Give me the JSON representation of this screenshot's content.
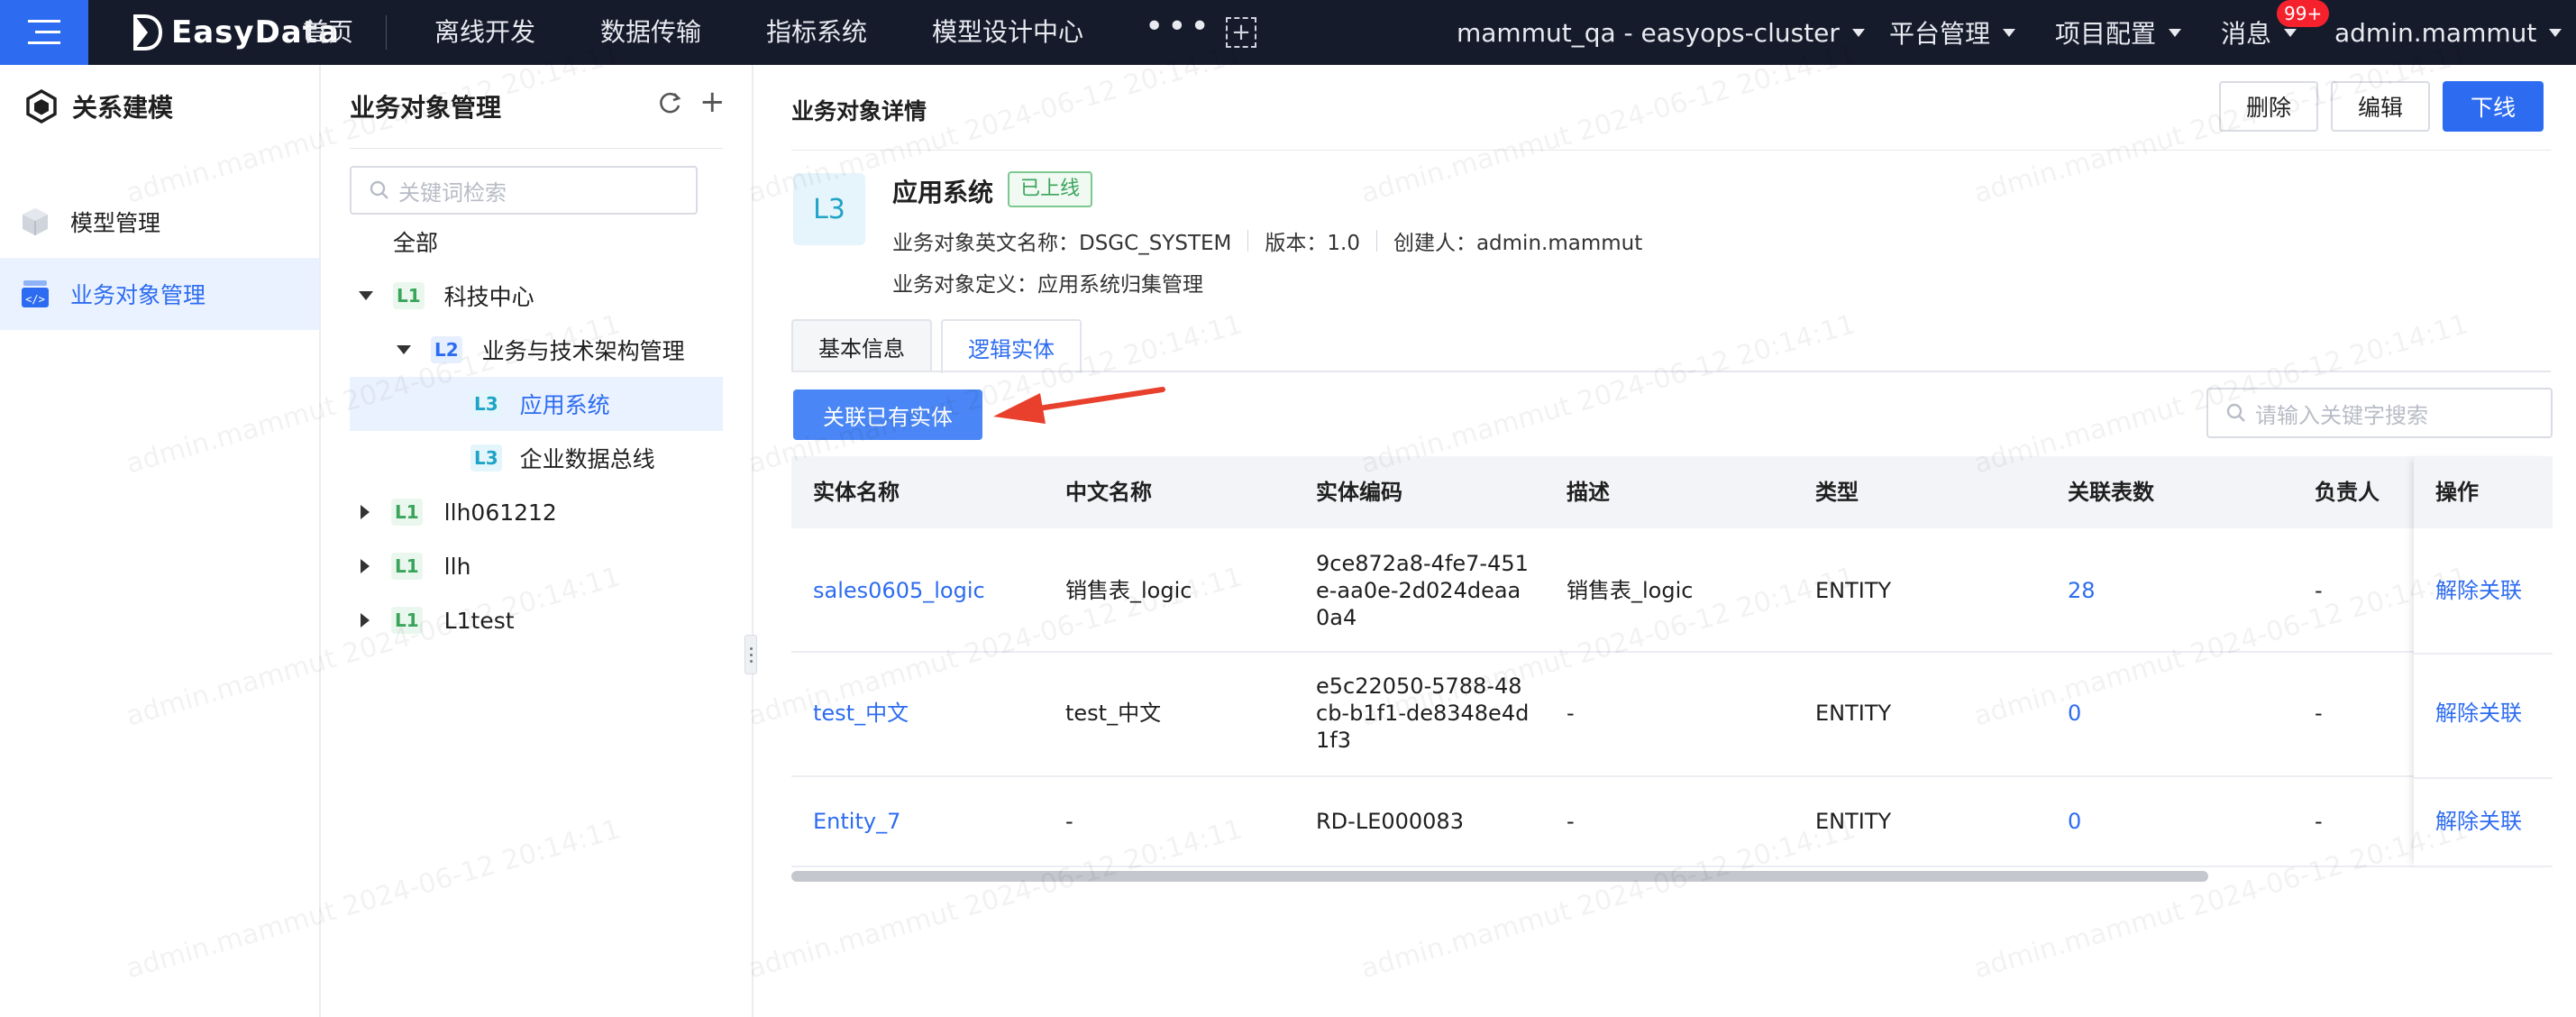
{
  "topbar": {
    "brand": "EasyData",
    "nav": [
      "首页",
      "离线开发",
      "数据传输",
      "指标系统",
      "模型设计中心"
    ],
    "more": "•••",
    "cluster": "mammut_qa - easyops-cluster",
    "platform": "平台管理",
    "project": "项目配置",
    "messages": "消息",
    "badge": "99+",
    "user": "admin.mammut"
  },
  "sidebar": {
    "title": "关系建模",
    "items": [
      {
        "label": "模型管理"
      },
      {
        "label": "业务对象管理"
      }
    ]
  },
  "tree": {
    "title": "业务对象管理",
    "search_placeholder": "关键词检索",
    "all": "全部",
    "nodes": [
      {
        "level": "L1",
        "label": "科技中心"
      },
      {
        "level": "L2",
        "label": "业务与技术架构管理"
      },
      {
        "level": "L3",
        "label": "应用系统"
      },
      {
        "level": "L3",
        "label": "企业数据总线"
      },
      {
        "level": "L1",
        "label": "llh061212"
      },
      {
        "level": "L1",
        "label": "llh"
      },
      {
        "level": "L1",
        "label": "L1test"
      }
    ]
  },
  "detail": {
    "title": "业务对象详情",
    "delete": "删除",
    "edit": "编辑",
    "offline": "下线",
    "level": "L3",
    "name": "应用系统",
    "status": "已上线",
    "en_name": "业务对象英文名称：DSGC_SYSTEM",
    "version": "版本：1.0",
    "creator": "创建人：admin.mammut",
    "definition": "业务对象定义：应用系统归集管理",
    "tabs": [
      "基本信息",
      "逻辑实体"
    ],
    "associate_button": "关联已有实体",
    "search_placeholder": "请输入关键字搜索"
  },
  "table": {
    "columns": [
      "实体名称",
      "中文名称",
      "实体编码",
      "描述",
      "类型",
      "关联表数",
      "负责人",
      "操作"
    ],
    "rows": [
      {
        "name": "sales0605_logic",
        "cn": "销售表_logic",
        "code": "9ce872a8-4fe7-451e-aa0e-2d024deaa0a4",
        "desc": "销售表_logic",
        "type": "ENTITY",
        "count": "28",
        "owner": "-",
        "op": "解除关联"
      },
      {
        "name": "test_中文",
        "cn": "test_中文",
        "code": "e5c22050-5788-48cb-b1f1-de8348e4d1f3",
        "desc": "-",
        "type": "ENTITY",
        "count": "0",
        "owner": "-",
        "op": "解除关联"
      },
      {
        "name": "Entity_7",
        "cn": "-",
        "code": "RD-LE000083",
        "desc": "-",
        "type": "ENTITY",
        "count": "0",
        "owner": "-",
        "op": "解除关联"
      }
    ]
  },
  "watermark": "admin.mammut 2024-06-12 20:14:11",
  "colors": {
    "primary": "#2d6cf0",
    "topbar": "#161b2b",
    "success": "#39a45a",
    "arrow": "#e8402c"
  }
}
